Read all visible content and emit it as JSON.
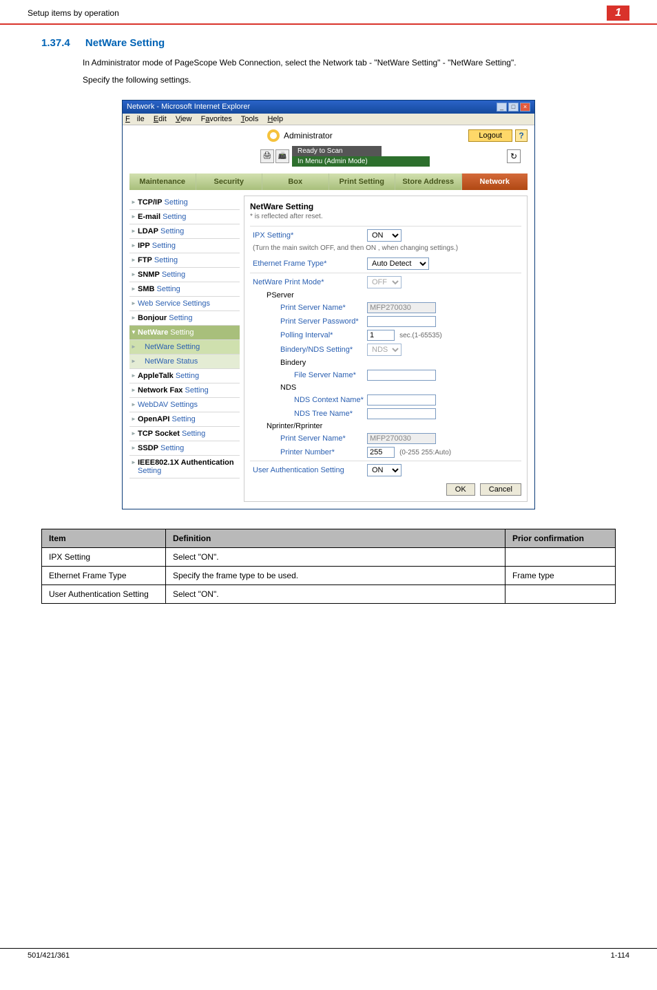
{
  "doc": {
    "header_left": "Setup items by operation",
    "header_right": "1",
    "section_number": "1.37.4",
    "section_name": "NetWare Setting",
    "para1": "In Administrator mode of PageScope Web Connection, select the Network tab - \"NetWare Setting\" - \"NetWare Setting\".",
    "para2": "Specify the following settings.",
    "footer_left": "501/421/361",
    "footer_right": "1-114"
  },
  "browser": {
    "title": "Network - Microsoft Internet Explorer",
    "menu": {
      "file": "File",
      "edit": "Edit",
      "view": "View",
      "favorites": "Favorites",
      "tools": "Tools",
      "help": "Help"
    }
  },
  "app": {
    "admin_label": "Administrator",
    "logout": "Logout",
    "help": "?",
    "ready_scan": "Ready to Scan",
    "in_menu": "In Menu (Admin Mode)",
    "tabs": {
      "maintenance": "Maintenance",
      "security": "Security",
      "box": "Box",
      "print": "Print Setting",
      "store": "Store Address",
      "network": "Network"
    },
    "sidebar": {
      "tcpip": {
        "a": "TCP/IP",
        "b": "Setting"
      },
      "email": {
        "a": "E-mail",
        "b": "Setting"
      },
      "ldap": {
        "a": "LDAP",
        "b": "Setting"
      },
      "ipp": {
        "a": "IPP",
        "b": "Setting"
      },
      "ftp": {
        "a": "FTP",
        "b": "Setting"
      },
      "snmp": {
        "a": "SNMP",
        "b": "Setting"
      },
      "smb": {
        "a": "SMB",
        "b": "Setting"
      },
      "websvc": "Web Service Settings",
      "bonjour": {
        "a": "Bonjour",
        "b": "Setting"
      },
      "netware": {
        "a": "NetWare",
        "b": "Setting"
      },
      "netware_setting": "NetWare Setting",
      "netware_status": "NetWare Status",
      "appletalk": {
        "a": "AppleTalk",
        "b": "Setting"
      },
      "netfax": {
        "a": "Network Fax",
        "b": "Setting"
      },
      "webdav": "WebDAV Settings",
      "openapi": {
        "a": "OpenAPI",
        "b": "Setting"
      },
      "tcpsocket": {
        "a": "TCP Socket",
        "b": "Setting"
      },
      "ssdp": {
        "a": "SSDP",
        "b": "Setting"
      },
      "ieee": {
        "a": "IEEE802.1X Authentication",
        "b": "Setting"
      }
    },
    "content": {
      "title": "NetWare Setting",
      "note": "* is reflected after reset.",
      "ipx_label": "IPX Setting*",
      "ipx_value": "ON",
      "ipx_hint": "(Turn the main switch OFF, and then ON , when changing settings.)",
      "eft_label": "Ethernet Frame Type*",
      "eft_value": "Auto Detect",
      "npm_label": "NetWare Print Mode*",
      "npm_value": "OFF",
      "pserver": "PServer",
      "psn_label": "Print Server Name*",
      "psn_value": "MFP270030",
      "psp_label": "Print Server Password*",
      "psp_value": "",
      "poll_label": "Polling Interval*",
      "poll_value": "1",
      "poll_unit": "sec.(1-65535)",
      "bns_label": "Bindery/NDS Setting*",
      "bns_value": "NDS",
      "bindery": "Bindery",
      "fsn_label": "File Server Name*",
      "nds": "NDS",
      "ndscn_label": "NDS Context Name*",
      "ndstn_label": "NDS Tree Name*",
      "nprinter": "Nprinter/Rprinter",
      "psn2_label": "Print Server Name*",
      "psn2_value": "MFP270030",
      "pnum_label": "Printer Number*",
      "pnum_value": "255",
      "pnum_hint": "(0-255    255:Auto)",
      "uas_label": "User Authentication Setting",
      "uas_value": "ON",
      "ok": "OK",
      "cancel": "Cancel"
    }
  },
  "deftable": {
    "h_item": "Item",
    "h_def": "Definition",
    "h_prior": "Prior confirmation",
    "rows": [
      {
        "item": "IPX Setting",
        "def": "Select \"ON\".",
        "prior": ""
      },
      {
        "item": "Ethernet Frame Type",
        "def": "Specify the frame type to be used.",
        "prior": "Frame type"
      },
      {
        "item": "User Authentication Setting",
        "def": "Select \"ON\".",
        "prior": ""
      }
    ]
  }
}
